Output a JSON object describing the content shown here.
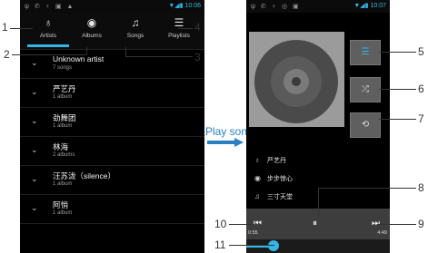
{
  "left_screen": {
    "status_time": "10:06",
    "tabs": [
      {
        "label": "Artists",
        "icon": "microphone-icon"
      },
      {
        "label": "Albums",
        "icon": "disc-icon"
      },
      {
        "label": "Songs",
        "icon": "music-note-icon"
      },
      {
        "label": "Playlists",
        "icon": "list-icon"
      }
    ],
    "artists": [
      {
        "name": "Unknown artist",
        "count": "7 songs"
      },
      {
        "name": "严艺丹",
        "count": "1 album"
      },
      {
        "name": "劲舞团",
        "count": "1 album"
      },
      {
        "name": "林海",
        "count": "2 albums"
      },
      {
        "name": "汪苏泷（silence）",
        "count": "1 album"
      },
      {
        "name": "阿悄",
        "count": "1 album"
      }
    ]
  },
  "play_label": "Play songs",
  "right_screen": {
    "status_time": "10:07",
    "artist": "严艺丹",
    "album": "步步惊心",
    "song": "三寸天堂",
    "elapsed": "0:55",
    "duration": "4:49",
    "progress": 0.19
  },
  "callouts": {
    "c1": "1",
    "c2": "2",
    "c3": "3",
    "c4": "4",
    "c5": "5",
    "c6": "6",
    "c7": "7",
    "c8": "8",
    "c9": "9",
    "c10": "10",
    "c11": "11"
  },
  "colors": {
    "accent": "#33b5e5",
    "background": "#000000"
  }
}
